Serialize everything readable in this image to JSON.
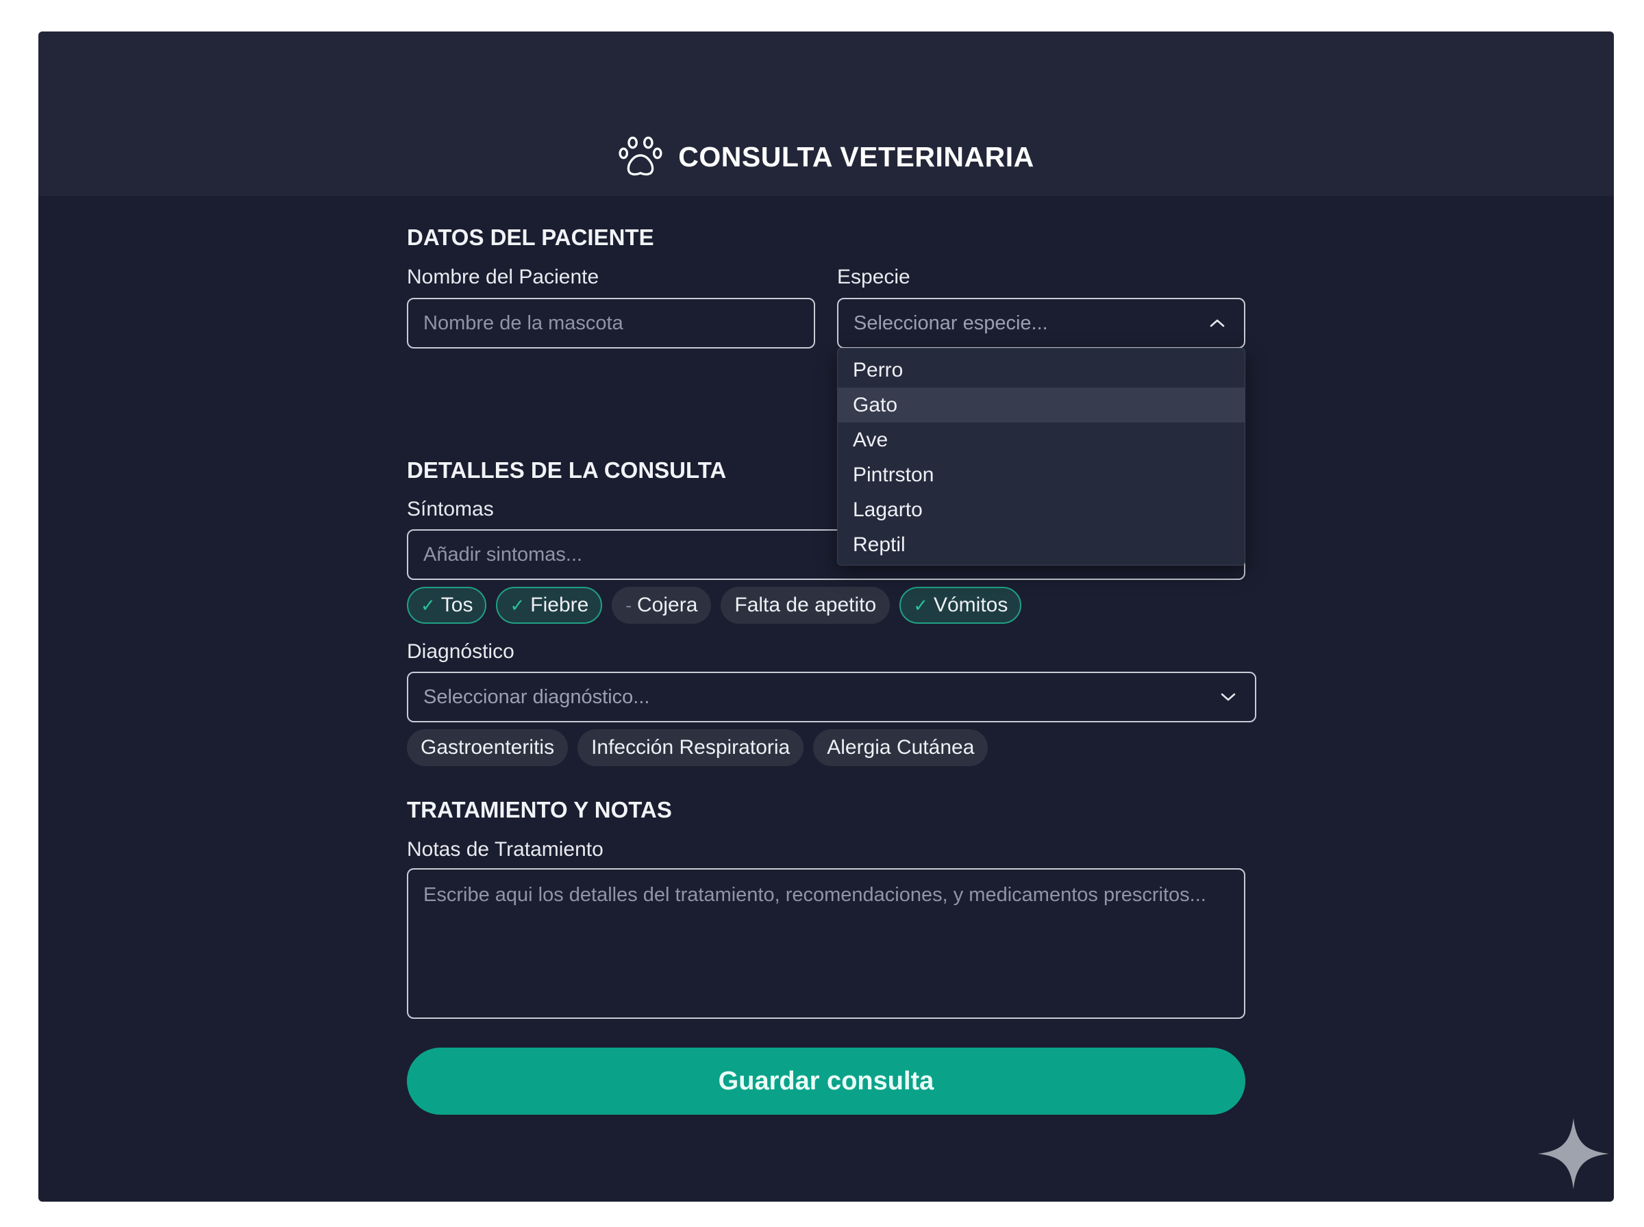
{
  "app": {
    "title": "CONSULTA VETERINARIA",
    "icon": "paw-icon"
  },
  "patient": {
    "section_title": "DATOS DEL PACIENTE",
    "name_label": "Nombre del Paciente",
    "name_placeholder": "Nombre de la mascota",
    "species_label": "Especie",
    "species_placeholder": "Seleccionar especie...",
    "species_options": [
      "Perro",
      "Gato",
      "Ave",
      "Pintrston",
      "Lagarto",
      "Reptil"
    ],
    "species_highlighted": "Gato"
  },
  "consulta": {
    "section_title": "DETALLES DE LA CONSULTA",
    "symptoms_label": "Síntomas",
    "symptoms_placeholder": "Añadir sintomas...",
    "symptom_chips": [
      {
        "label": "Tos",
        "selected": true
      },
      {
        "label": "Fiebre",
        "selected": true
      },
      {
        "label": "Cojera",
        "selected": false,
        "marker": "-"
      },
      {
        "label": "Falta de apetito",
        "selected": false
      },
      {
        "label": "Vómitos",
        "selected": true
      }
    ],
    "diagnosis_label": "Diagnóstico",
    "diagnosis_placeholder": "Seleccionar diagnóstico...",
    "diagnosis_chips": [
      "Gastroenteritis",
      "Infección Respiratoria",
      "Alergia Cutánea"
    ]
  },
  "treatment": {
    "section_title": "TRATAMIENTO Y NOTAS",
    "notes_label": "Notas de Tratamiento",
    "notes_placeholder": "Escribe aqui los detalles del tratamiento, recomendaciones, y medicamentos prescritos..."
  },
  "actions": {
    "save_label": "Guardar consulta"
  },
  "colors": {
    "background": "#1b1e30",
    "header": "#222638",
    "accent": "#0aa38a",
    "chip_selected_border": "#1fa086",
    "check": "#27c39c"
  }
}
